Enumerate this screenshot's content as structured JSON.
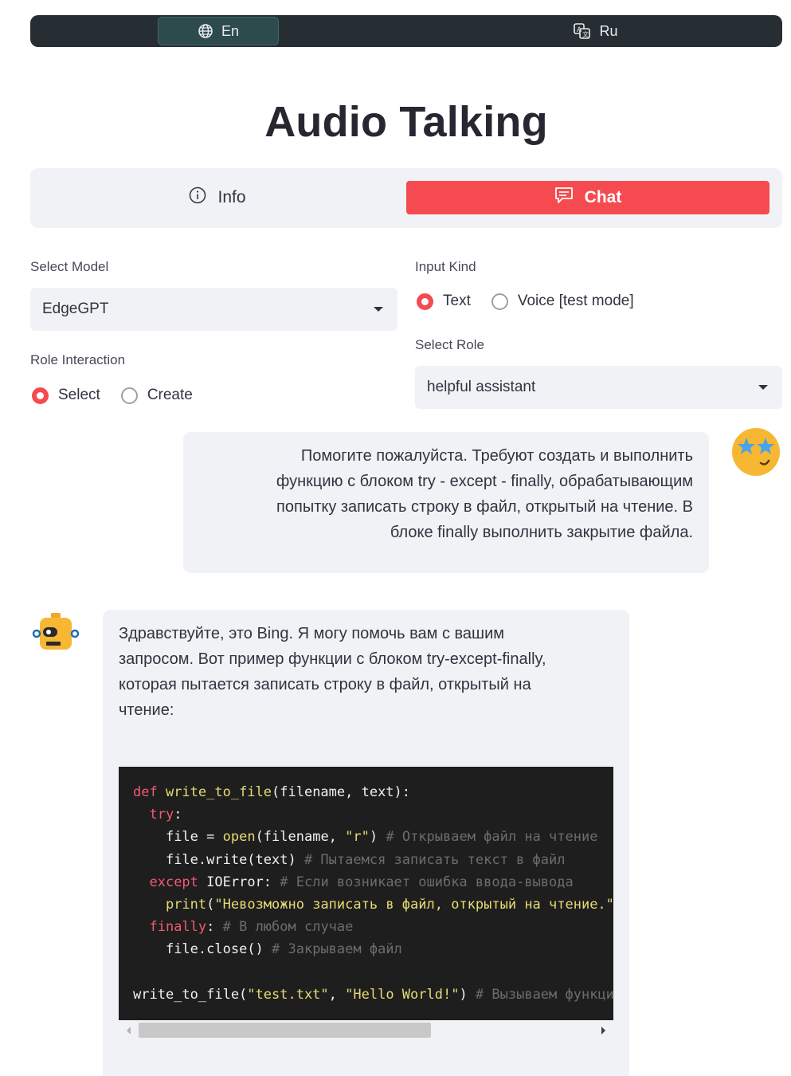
{
  "language_bar": {
    "en_label": "En",
    "ru_label": "Ru",
    "active": "En"
  },
  "title": "Audio Talking",
  "tabs": {
    "info_label": "Info",
    "chat_label": "Chat",
    "active": "Chat"
  },
  "select_model": {
    "label": "Select Model",
    "value": "EdgeGPT"
  },
  "input_kind": {
    "label": "Input Kind",
    "options": [
      "Text",
      "Voice [test mode]"
    ],
    "selected": "Text"
  },
  "role_interaction": {
    "label": "Role Interaction",
    "options": [
      "Select",
      "Create"
    ],
    "selected": "Select"
  },
  "select_role": {
    "label": "Select Role",
    "value": "helpful assistant"
  },
  "messages": {
    "user": {
      "lines": [
        "Помогите пожалуйста. Требуют создать и выполнить",
        "функцию с блоком try - except - finally, обрабатывающим",
        "попытку записать строку в файл, открытый на чтение. В",
        "блоке finally выполнить закрытие файла."
      ]
    },
    "assistant": {
      "lines": [
        "Здравствуйте, это Bing. Я могу помочь вам с вашим",
        "запросом. Вот пример функции с блоком try-except-finally,",
        "которая пытается записать строку в файл, открытый на",
        "чтение:"
      ],
      "code": {
        "l1_def": "def ",
        "l1_fn": "write_to_file",
        "l1_rest": "(filename, text):",
        "l2_kw": "try",
        "l2_rest": ":",
        "l3_a": "file = ",
        "l3_fn": "open",
        "l3_b": "(filename, ",
        "l3_str": "\"r\"",
        "l3_c": ") ",
        "l3_cm": "# Открываем файл на чтение",
        "l4_a": "file.write(text) ",
        "l4_cm": "# Пытаемся записать текст в файл",
        "l5_kw": "except",
        "l5_a": " IOError: ",
        "l5_cm": "# Если возникает ошибка ввода-вывода",
        "l6_fn": "print",
        "l6_a": "(",
        "l6_str": "\"Невозможно записать в файл, открытый на чтение.\"",
        "l6_b": ")",
        "l7_kw": "finally",
        "l7_a": ": ",
        "l7_cm": "# В любом случае",
        "l8_a": "file.close() ",
        "l8_cm": "# Закрываем файл",
        "l10_a": "write_to_file(",
        "l10_str1": "\"test.txt\"",
        "l10_b": ", ",
        "l10_str2": "\"Hello World!\"",
        "l10_c": ") ",
        "l10_cm": "# Вызываем функцию"
      }
    }
  },
  "colors": {
    "accent": "#f54b50",
    "langbar_bg": "#262d33",
    "panel_bg": "#f0f2f6",
    "code_bg": "#1e1e1e"
  },
  "icons": {
    "en": "globe-icon",
    "ru": "translate-icon",
    "info": "info-icon",
    "chat": "chat-icon",
    "user_avatar": "star-eyes-emoji",
    "bot_avatar": "robot-avatar"
  }
}
